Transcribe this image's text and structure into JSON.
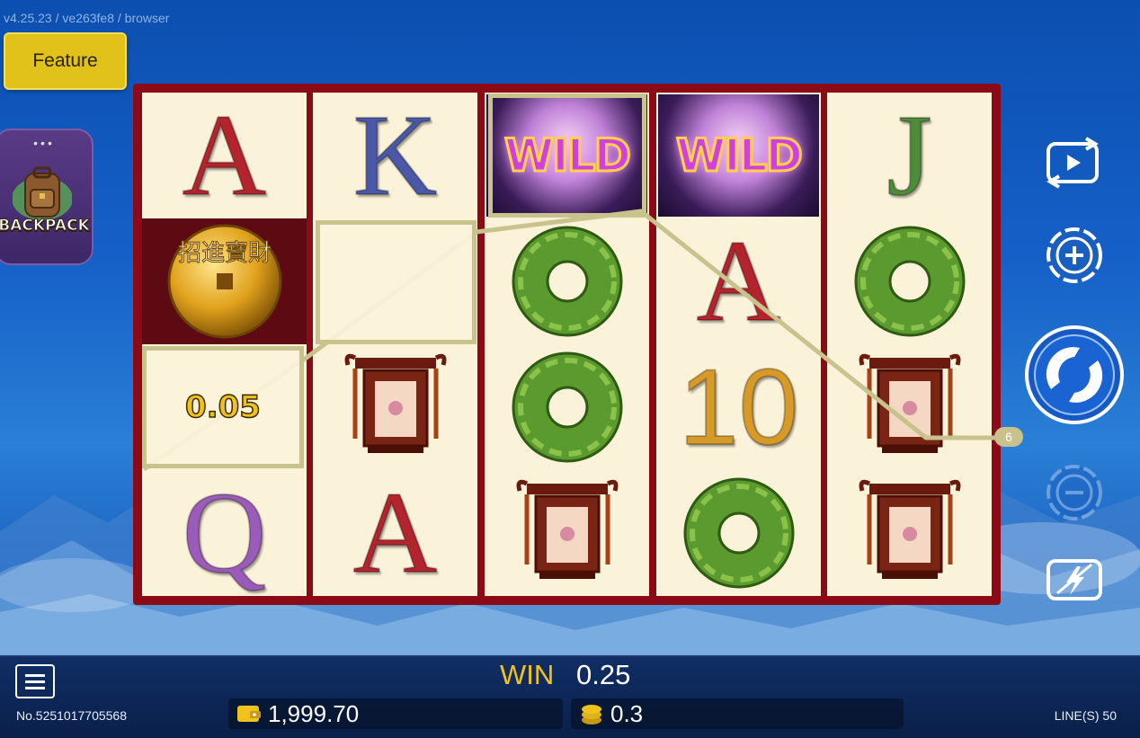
{
  "version": "v4.25.23 / ve263fe8 / browser",
  "feature_button": "Feature",
  "backpack": {
    "dots": "•••",
    "label": "BACKPACK"
  },
  "reels": [
    {
      "cells": [
        {
          "type": "letter",
          "value": "A",
          "color": "red"
        },
        {
          "type": "coin",
          "value": "招進寶財"
        },
        {
          "type": "prize",
          "value": "0.05"
        },
        {
          "type": "letter",
          "value": "Q",
          "color": "purple"
        }
      ]
    },
    {
      "cells": [
        {
          "type": "letter",
          "value": "K",
          "color": "blue"
        },
        {
          "type": "empty",
          "value": ""
        },
        {
          "type": "lantern",
          "value": ""
        },
        {
          "type": "letter",
          "value": "A",
          "color": "red"
        }
      ]
    },
    {
      "cells": [
        {
          "type": "wild",
          "value": "WILD"
        },
        {
          "type": "jade",
          "value": ""
        },
        {
          "type": "jade",
          "value": ""
        },
        {
          "type": "lantern",
          "value": ""
        }
      ]
    },
    {
      "cells": [
        {
          "type": "wild",
          "value": "WILD"
        },
        {
          "type": "letter",
          "value": "A",
          "color": "red"
        },
        {
          "type": "letter",
          "value": "10",
          "color": "gold"
        },
        {
          "type": "jade",
          "value": ""
        }
      ]
    },
    {
      "cells": [
        {
          "type": "letter",
          "value": "J",
          "color": "green"
        },
        {
          "type": "jade",
          "value": ""
        },
        {
          "type": "lantern",
          "value": ""
        },
        {
          "type": "lantern",
          "value": ""
        }
      ]
    }
  ],
  "payline_number": "6",
  "side_buttons": [
    "replay-icon",
    "bet-plus-icon",
    "spin-icon",
    "bet-minus-icon",
    "turbo-icon"
  ],
  "bottom": {
    "win_label": "WIN",
    "win_value": "0.25",
    "balance": "1,999.70",
    "bet": "0.3",
    "ticket": "No.5251017705568",
    "lines": "LINE(S) 50"
  },
  "colors": {
    "accent_gold": "#f2c21c",
    "reel_frame": "#8b0a16",
    "feature_button": "#e0c21a"
  }
}
